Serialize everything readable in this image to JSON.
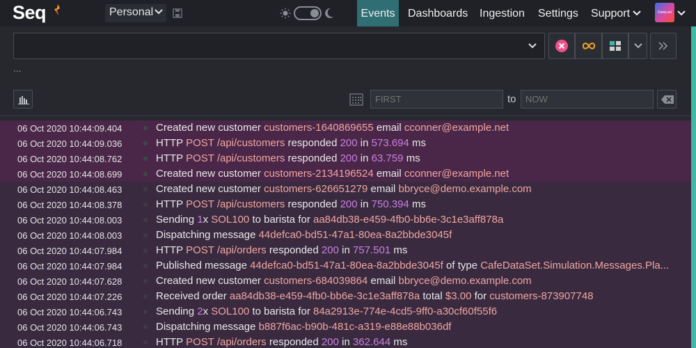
{
  "app": {
    "logo": "Seq",
    "workspace": "Personal",
    "avatar_text": "DataLust"
  },
  "nav": {
    "events": "Events",
    "dashboards": "Dashboards",
    "ingestion": "Ingestion",
    "settings": "Settings",
    "support": "Support"
  },
  "filter": {
    "query_value": "",
    "more": "..."
  },
  "range": {
    "from_placeholder": "FIRST",
    "to_label": "to",
    "to_placeholder": "NOW"
  },
  "colors": {
    "accent": "#3fb8a8",
    "active_tab": "#2f6e73",
    "error_row": "#4a2748",
    "property_string": "#f0a6a0",
    "property_number": "#c880e0"
  },
  "events": [
    {
      "ts": "06 Oct 2020  10:44:09.404",
      "level": "error",
      "parts": [
        {
          "t": "Created new customer "
        },
        {
          "t": "customers-1640869655",
          "k": "str"
        },
        {
          "t": " email "
        },
        {
          "t": "cconner@example.net",
          "k": "str"
        }
      ]
    },
    {
      "ts": "06 Oct 2020  10:44:09.036",
      "level": "error",
      "parts": [
        {
          "t": "HTTP "
        },
        {
          "t": "POST",
          "k": "str"
        },
        {
          "t": " "
        },
        {
          "t": "/api/customers",
          "k": "str"
        },
        {
          "t": " responded "
        },
        {
          "t": "200",
          "k": "num"
        },
        {
          "t": " in "
        },
        {
          "t": "573.694",
          "k": "num"
        },
        {
          "t": " ms"
        }
      ]
    },
    {
      "ts": "06 Oct 2020  10:44:08.762",
      "level": "error",
      "parts": [
        {
          "t": "HTTP "
        },
        {
          "t": "POST",
          "k": "str"
        },
        {
          "t": " "
        },
        {
          "t": "/api/customers",
          "k": "str"
        },
        {
          "t": " responded "
        },
        {
          "t": "200",
          "k": "num"
        },
        {
          "t": " in "
        },
        {
          "t": "63.759",
          "k": "num"
        },
        {
          "t": " ms"
        }
      ]
    },
    {
      "ts": "06 Oct 2020  10:44:08.699",
      "level": "error",
      "parts": [
        {
          "t": "Created new customer "
        },
        {
          "t": "customers-2134196524",
          "k": "str"
        },
        {
          "t": " email "
        },
        {
          "t": "cconner@example.net",
          "k": "str"
        }
      ]
    },
    {
      "ts": "06 Oct 2020  10:44:08.463",
      "level": "info",
      "parts": [
        {
          "t": "Created new customer "
        },
        {
          "t": "customers-626651279",
          "k": "str"
        },
        {
          "t": " email "
        },
        {
          "t": "bbryce@demo.example.com",
          "k": "str"
        }
      ]
    },
    {
      "ts": "06 Oct 2020  10:44:08.378",
      "level": "info",
      "parts": [
        {
          "t": "HTTP "
        },
        {
          "t": "POST",
          "k": "str"
        },
        {
          "t": " "
        },
        {
          "t": "/api/customers",
          "k": "str"
        },
        {
          "t": " responded "
        },
        {
          "t": "200",
          "k": "num"
        },
        {
          "t": " in "
        },
        {
          "t": "750.394",
          "k": "num"
        },
        {
          "t": " ms"
        }
      ]
    },
    {
      "ts": "06 Oct 2020  10:44:08.003",
      "level": "info",
      "parts": [
        {
          "t": "Sending "
        },
        {
          "t": "1",
          "k": "num"
        },
        {
          "t": "x "
        },
        {
          "t": "SOL100",
          "k": "str"
        },
        {
          "t": " to barista for "
        },
        {
          "t": "aa84db38-e459-4fb0-bb6e-3c1e3aff878a",
          "k": "str"
        }
      ]
    },
    {
      "ts": "06 Oct 2020  10:44:08.003",
      "level": "info",
      "parts": [
        {
          "t": "Dispatching message "
        },
        {
          "t": "44defca0-bd51-47a1-80ea-8a2bbde3045f",
          "k": "str"
        }
      ]
    },
    {
      "ts": "06 Oct 2020  10:44:07.984",
      "level": "info",
      "parts": [
        {
          "t": "HTTP "
        },
        {
          "t": "POST",
          "k": "str"
        },
        {
          "t": " "
        },
        {
          "t": "/api/orders",
          "k": "str"
        },
        {
          "t": " responded "
        },
        {
          "t": "200",
          "k": "num"
        },
        {
          "t": " in "
        },
        {
          "t": "757.501",
          "k": "num"
        },
        {
          "t": " ms"
        }
      ]
    },
    {
      "ts": "06 Oct 2020  10:44:07.984",
      "level": "info",
      "parts": [
        {
          "t": "Published message "
        },
        {
          "t": "44defca0-bd51-47a1-80ea-8a2bbde3045f",
          "k": "str"
        },
        {
          "t": " of type "
        },
        {
          "t": "CafeDataSet.Simulation.Messages.Pla...",
          "k": "str"
        }
      ]
    },
    {
      "ts": "06 Oct 2020  10:44:07.628",
      "level": "info",
      "parts": [
        {
          "t": "Created new customer "
        },
        {
          "t": "customers-684039864",
          "k": "str"
        },
        {
          "t": " email "
        },
        {
          "t": "bbryce@demo.example.com",
          "k": "str"
        }
      ]
    },
    {
      "ts": "06 Oct 2020  10:44:07.226",
      "level": "info",
      "parts": [
        {
          "t": "Received order "
        },
        {
          "t": "aa84db38-e459-4fb0-bb6e-3c1e3aff878a",
          "k": "str"
        },
        {
          "t": " total "
        },
        {
          "t": "$3.00",
          "k": "str"
        },
        {
          "t": " for "
        },
        {
          "t": "customers-873907748",
          "k": "str"
        }
      ]
    },
    {
      "ts": "06 Oct 2020  10:44:06.743",
      "level": "info",
      "parts": [
        {
          "t": "Sending "
        },
        {
          "t": "2",
          "k": "num"
        },
        {
          "t": "x "
        },
        {
          "t": "SOL100",
          "k": "str"
        },
        {
          "t": " to barista for "
        },
        {
          "t": "84a2913e-774e-4cd5-9ff0-a30cf60f55f6",
          "k": "str"
        }
      ]
    },
    {
      "ts": "06 Oct 2020  10:44:06.743",
      "level": "info",
      "parts": [
        {
          "t": "Dispatching message "
        },
        {
          "t": "b887f6ac-b90b-481c-a319-e88e88b036df",
          "k": "str"
        }
      ]
    },
    {
      "ts": "06 Oct 2020  10:44:06.718",
      "level": "info",
      "parts": [
        {
          "t": "HTTP "
        },
        {
          "t": "POST",
          "k": "str"
        },
        {
          "t": " "
        },
        {
          "t": "/api/orders",
          "k": "str"
        },
        {
          "t": " responded "
        },
        {
          "t": "200",
          "k": "num"
        },
        {
          "t": " in "
        },
        {
          "t": "362.644",
          "k": "num"
        },
        {
          "t": " ms"
        }
      ]
    }
  ]
}
